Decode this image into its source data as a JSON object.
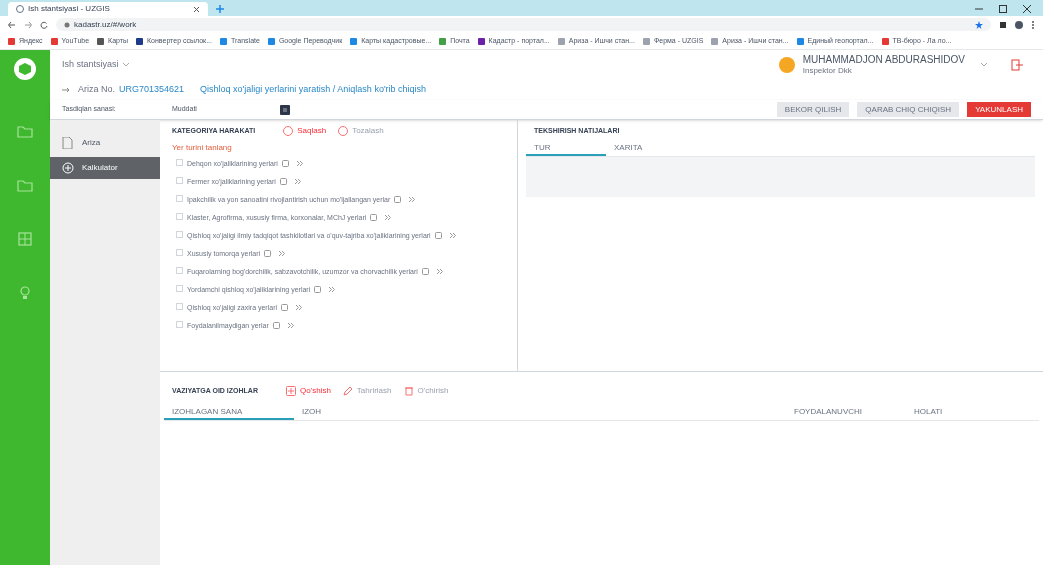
{
  "browser": {
    "tab_title": "Ish stantsiyasi - UZGIS",
    "address": "kadastr.uz/#/work",
    "bookmarks": [
      {
        "label": "Яндекс",
        "color": "#e53935"
      },
      {
        "label": "YouTube",
        "color": "#e53935"
      },
      {
        "label": "Карты",
        "color": "#555555"
      },
      {
        "label": "Конвертер ссылок...",
        "color": "#1e3a8a"
      },
      {
        "label": "Translate",
        "color": "#1e88e5"
      },
      {
        "label": "Google Переводчик",
        "color": "#1e88e5"
      },
      {
        "label": "Карты кадастровые...",
        "color": "#1e88e5"
      },
      {
        "label": "Почта",
        "color": "#43a047"
      },
      {
        "label": "Кадастр - портал...",
        "color": "#6b21a8"
      },
      {
        "label": "Ариза - Ишчи стан...",
        "color": "#9ca3af"
      },
      {
        "label": "Ферма - UZGIS",
        "color": "#9ca3af"
      },
      {
        "label": "Ариза - Ишчи стан...",
        "color": "#9ca3af"
      },
      {
        "label": "Единый геопортал...",
        "color": "#1e88e5"
      },
      {
        "label": "ТВ-бюро - Ла ло...",
        "color": "#e53935"
      }
    ]
  },
  "app": {
    "workspace": "Ish stantsiyasi",
    "user": {
      "name": "MUHAMMADJON ABDURASHIDOV",
      "role": "Inspektor Dkk"
    },
    "application_label": "Ariza No.",
    "application_number": "URG701354621",
    "application_title": "Qishloq xo'jaligi yerlarini yaratish / Aniqlash ko'rib chiqish",
    "date_label": "Tasdiqlan sanasi:",
    "deadline_label": "Muddati",
    "actions": [
      {
        "label": "BEKOR QILISH",
        "kind": "secondary"
      },
      {
        "label": "QARAB CHIQ CHIQISH",
        "kind": "secondary"
      },
      {
        "label": "YAKUNLASH",
        "kind": "primary"
      }
    ],
    "menu": [
      {
        "label": "Ariza",
        "selected": false
      },
      {
        "label": "Kalkulator",
        "selected": true
      }
    ],
    "category_panel": {
      "title": "KATEGORIYA HARAKATI",
      "buttons": [
        {
          "label": "Saqlash",
          "disabled": false
        },
        {
          "label": "Tozalash",
          "disabled": true
        }
      ],
      "prompt": "Yer turini tanlang",
      "options": [
        {
          "label": "Dehqon xo'jaliklarining yerlari",
          "checked": false
        },
        {
          "label": "Fermer xo'jaliklarining yerlari",
          "checked": false
        },
        {
          "label": "Ipakchilik va yon sanoatini rivojlantirish uchun mo'ljallangan yerlar",
          "checked": false
        },
        {
          "label": "Klaster, Agrofirma, xususiy firma, korxonalar, MChJ yerlari",
          "checked": false
        },
        {
          "label": "Qishloq xo'jaligi ilmiy tadqiqot tashkilotlari va o'quv-tajriba xo'jaliklarining yerlari",
          "checked": false
        },
        {
          "label": "Xususiy tomorqa yerlari",
          "checked": false
        },
        {
          "label": "Fuqarolarning bog'dorchilik, sabzavotchilik, uzumzor va chorvachilik yerlari",
          "checked": false
        },
        {
          "label": "Yordamchi qishloq xo'jaliklarining yerlari",
          "checked": false
        },
        {
          "label": "Qishloq xo'jaligi zaxira yerlari",
          "checked": false
        },
        {
          "label": "Foydalanilmaydigan yerlar",
          "checked": false
        }
      ]
    },
    "results_panel": {
      "title": "TEKSHIRISH NATIJALARI",
      "tabs": [
        {
          "label": "TUR",
          "selected": true
        },
        {
          "label": "XARITA",
          "selected": false
        }
      ]
    },
    "notes_panel": {
      "title": "VAZIYATGA OID IZOHLAR",
      "buttons": [
        {
          "label": "Qo'shish",
          "disabled": false
        },
        {
          "label": "Tahrirlash",
          "disabled": true
        },
        {
          "label": "O'chirish",
          "disabled": true
        }
      ],
      "columns": [
        {
          "label": "IZOHLAGAN SANA",
          "sorted": true
        },
        {
          "label": "IZOH",
          "sorted": false
        },
        {
          "label": "FOYDALANUVCHI",
          "sorted": false
        },
        {
          "label": "HOLATI",
          "sorted": false
        }
      ]
    }
  }
}
